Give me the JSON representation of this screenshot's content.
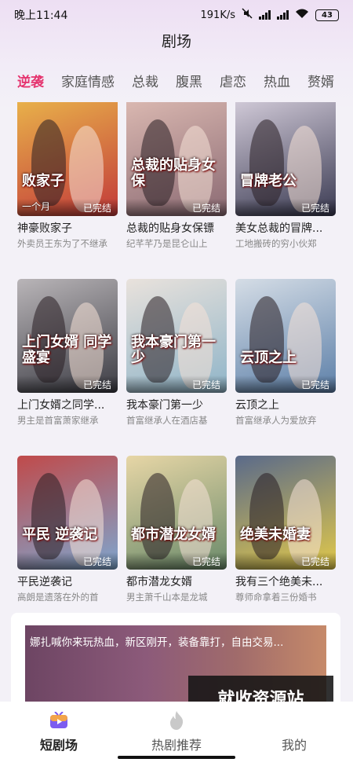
{
  "status_bar": {
    "time": "晚上11:44",
    "net_speed": "191K/s",
    "battery": "43"
  },
  "header": {
    "title": "剧场"
  },
  "tabs": [
    {
      "label": "逆袭",
      "active": true
    },
    {
      "label": "家庭情感",
      "active": false
    },
    {
      "label": "总裁",
      "active": false
    },
    {
      "label": "腹黑",
      "active": false
    },
    {
      "label": "虐恋",
      "active": false
    },
    {
      "label": "热血",
      "active": false
    },
    {
      "label": "赘婿",
      "active": false
    }
  ],
  "dramas": [
    {
      "title": "神豪败家子",
      "desc": "外卖员王东为了不继承",
      "status": "已完结",
      "poster_text": "败家子",
      "poster_side": "一个月",
      "colors": [
        "#c23a3a",
        "#e8b04a"
      ]
    },
    {
      "title": "总裁的贴身女保镖",
      "desc": "纪芊芊乃是昆仑山上",
      "status": "已完结",
      "poster_text": "总裁的贴身女保",
      "poster_side": "",
      "colors": [
        "#8b6a73",
        "#d9b7b0"
      ]
    },
    {
      "title": "美女总裁的冒牌...",
      "desc": "工地搬砖的穷小伙郑",
      "status": "已完结",
      "poster_text": "冒牌老公",
      "poster_side": "",
      "colors": [
        "#3a3a52",
        "#cfc8d6"
      ]
    },
    {
      "title": "上门女婿之同学...",
      "desc": "男主是首富萧家继承",
      "status": "已完结",
      "poster_text": "上门女婿 同学盛宴",
      "poster_side": "",
      "colors": [
        "#3c3c44",
        "#b9b5b8"
      ]
    },
    {
      "title": "我本豪门第一少",
      "desc": "首富继承人在酒店基",
      "status": "已完结",
      "poster_text": "我本豪门第一少",
      "poster_side": "",
      "colors": [
        "#8fb4c8",
        "#e9e2dc"
      ]
    },
    {
      "title": "云顶之上",
      "desc": "首富继承人为爱放弃",
      "status": "已完结",
      "poster_text": "云顶之上",
      "poster_side": "",
      "colors": [
        "#5c7fa8",
        "#d5dde6"
      ]
    },
    {
      "title": "平民逆袭记",
      "desc": "高朗是遗落在外的首",
      "status": "已完结",
      "poster_text": "平民 逆袭记",
      "poster_side": "",
      "colors": [
        "#7ea6cf",
        "#c04a4a"
      ]
    },
    {
      "title": "都市潜龙女婿",
      "desc": "男主萧千山本是龙城",
      "status": "已完结",
      "poster_text": "都市潜龙女婿",
      "poster_side": "",
      "colors": [
        "#6a8a6a",
        "#e7d6a6"
      ]
    },
    {
      "title": "我有三个绝美未...",
      "desc": "尊师命拿着三份婚书",
      "status": "已完结",
      "poster_text": "绝美未婚妻",
      "poster_side": "",
      "colors": [
        "#e2c94a",
        "#5a6a8a"
      ]
    }
  ],
  "ad": {
    "text": "娜扎喊你来玩热血，新区刚开，装备靠打，自由交易..."
  },
  "watermark": "就收资源站",
  "bottom_nav": [
    {
      "label": "短剧场",
      "icon": "video-icon",
      "active": true
    },
    {
      "label": "热剧推荐",
      "icon": "flame-icon",
      "active": false
    },
    {
      "label": "我的",
      "icon": "",
      "active": false
    }
  ],
  "accent_color": "#e5336e"
}
